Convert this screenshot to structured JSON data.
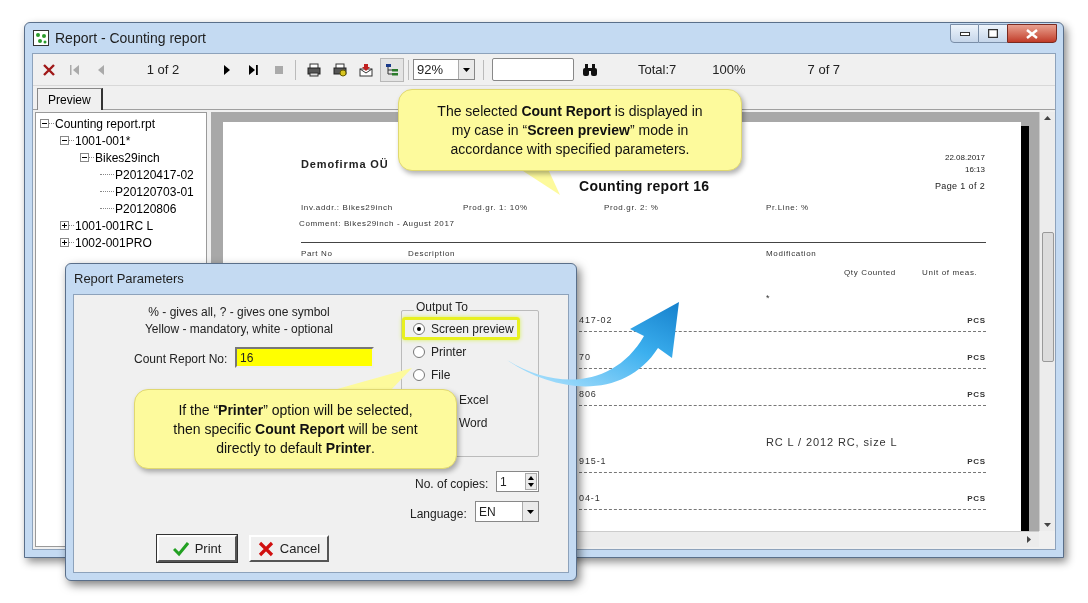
{
  "window": {
    "title": "Report - Counting report"
  },
  "toolbar": {
    "page_indicator": "1 of 2",
    "zoom": "92%",
    "total": "Total:7",
    "percent": "100%",
    "record": "7 of 7",
    "tree_toggle_on": true
  },
  "tabs": [
    {
      "label": "Preview",
      "selected": true
    }
  ],
  "tree": [
    {
      "label": "Counting report.rpt",
      "expanded": true,
      "children": [
        {
          "label": "1001-001*",
          "expanded": true,
          "children": [
            {
              "label": "Bikes29inch",
              "expanded": true,
              "children": [
                {
                  "label": "P20120417-02"
                },
                {
                  "label": "P20120703-01"
                },
                {
                  "label": "P20120806"
                }
              ]
            }
          ]
        },
        {
          "label": "1001-001RC L",
          "expanded": false
        },
        {
          "label": "1002-001PRO",
          "expanded": false
        }
      ]
    }
  ],
  "report": {
    "company": "Demofirma OÜ",
    "date": "22.08.2017",
    "time": "16:13",
    "page": "Page 1 of 2",
    "title": "Counting report  16",
    "header_fields": [
      "Inv.addr.: Bikes29inch",
      "Prod.gr. 1: 10%",
      "Prod.gr. 2: %",
      "Pr.Line: %"
    ],
    "comment": "Comment: Bikes29inch - August 2017",
    "columns": [
      "Part No",
      "Description",
      "Modification"
    ],
    "subcolumns": [
      "Qty Counted",
      "Unit of meas."
    ],
    "marker": "*",
    "rows": [
      {
        "kind": "item",
        "part": "417-02",
        "unit": "PCS"
      },
      {
        "kind": "item",
        "part": "70",
        "unit": "PCS"
      },
      {
        "kind": "item",
        "part": "806",
        "unit": "PCS"
      },
      {
        "kind": "group",
        "text": "RC L / 2012 RC, size L"
      },
      {
        "kind": "item",
        "part": "915-1",
        "unit": "PCS"
      },
      {
        "kind": "item",
        "part": "04-1",
        "unit": "PCS"
      }
    ]
  },
  "dialog": {
    "title": "Report Parameters",
    "hints": [
      "% - gives all, ? - gives one symbol",
      "Yellow - mandatory, white - optional"
    ],
    "count_report_no": {
      "label": "Count Report No:",
      "value": "16",
      "mandatory": true
    },
    "output_to": {
      "label": "Output To",
      "options": [
        {
          "label": "Screen preview",
          "selected": true,
          "highlighted": true
        },
        {
          "label": "Printer",
          "selected": false
        },
        {
          "label": "File",
          "selected": false
        }
      ],
      "covered_options": [
        "Excel",
        "Word"
      ]
    },
    "copies": {
      "label": "No. of copies:",
      "value": "1"
    },
    "language": {
      "label": "Language:",
      "value": "EN"
    },
    "buttons": [
      {
        "label": "Print",
        "kind": "ok"
      },
      {
        "label": "Cancel",
        "kind": "cancel"
      }
    ]
  },
  "callouts": [
    "The selected **Count Report** is displayed in my case in “**Screen preview**” mode in accordance with specified parameters.",
    "If the “**Printer**” option will be selected, then specific **Count Report** will be sent directly to default **Printer**."
  ]
}
